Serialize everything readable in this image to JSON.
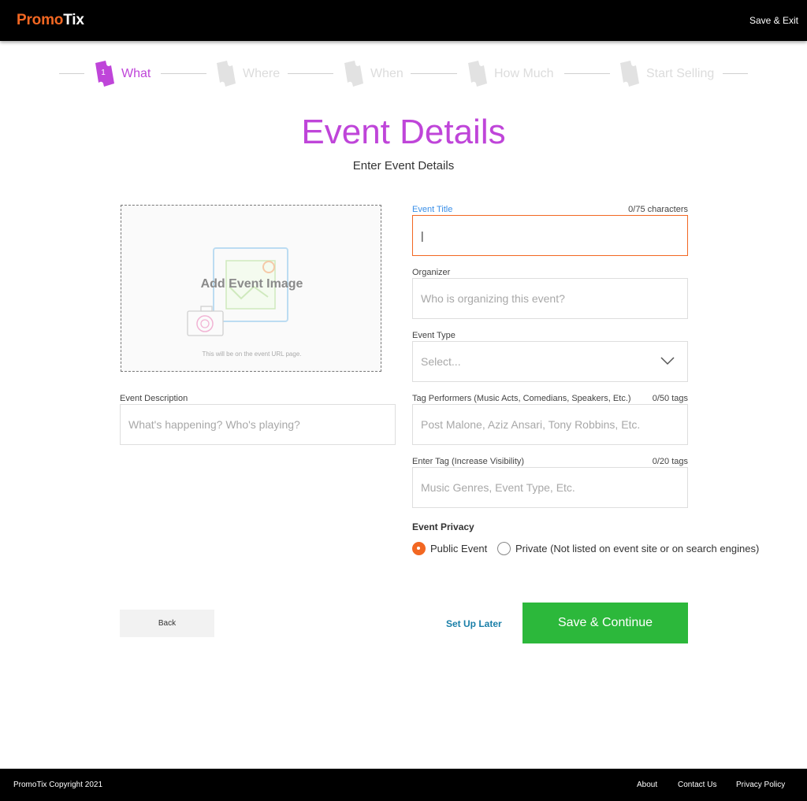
{
  "header": {
    "logo_part1": "Promo",
    "logo_part2": "Tix",
    "save_exit": "Save & Exit",
    "colors": {
      "brand_orange": "#f26722",
      "background": "#000000"
    }
  },
  "stepper": {
    "steps": [
      {
        "label": "What",
        "number": "1",
        "active": true
      },
      {
        "label": "Where",
        "active": false
      },
      {
        "label": "When",
        "active": false
      },
      {
        "label": "How Much",
        "active": false
      },
      {
        "label": "Start Selling",
        "active": false
      }
    ],
    "active_color": "#bf45d9"
  },
  "page": {
    "title": "Event Details",
    "subtitle": "Enter Event Details"
  },
  "image_upload": {
    "label": "Add Event Image",
    "hint": "This will be on the event URL page.",
    "icons": [
      "image-placeholder-icon",
      "camera-icon"
    ]
  },
  "form": {
    "event_title": {
      "label": "Event Title",
      "count": "0/75 characters",
      "value": "|",
      "placeholder": ""
    },
    "organizer": {
      "label": "Organizer",
      "placeholder": "Who is organizing this event?"
    },
    "event_type": {
      "label": "Event Type",
      "value": "Select..."
    },
    "event_description": {
      "label": "Event Description",
      "placeholder": "What's happening? Who's playing?"
    },
    "tag_performers": {
      "label": "Tag Performers (Music Acts, Comedians, Speakers, Etc.)",
      "count": "0/50 tags",
      "placeholder": "Post Malone, Aziz Ansari, Tony Robbins, Etc."
    },
    "enter_tag": {
      "label": "Enter Tag (Increase Visibility)",
      "count": "0/20 tags",
      "placeholder": "Music Genres, Event Type, Etc."
    },
    "privacy": {
      "title": "Event Privacy",
      "options": [
        {
          "label": "Public Event",
          "selected": true
        },
        {
          "label": "Private (Not listed on event site or on search engines)",
          "selected": false
        }
      ]
    }
  },
  "actions": {
    "back": "Back",
    "setup_later": "Set Up Later",
    "save_continue": "Save & Continue",
    "save_color": "#2cb83b"
  },
  "footer": {
    "copyright": "PromoTix Copyright 2021",
    "links": [
      "About",
      "Contact Us",
      "Privacy Policy"
    ]
  }
}
